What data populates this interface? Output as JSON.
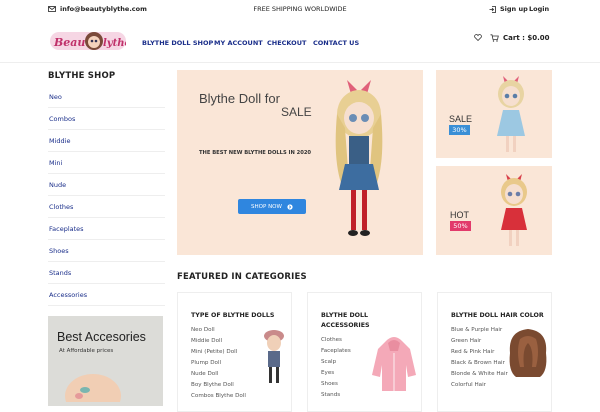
{
  "topbar": {
    "email": "info@beautyblythe.com",
    "shipping": "FREE SHIPPING WORLDWIDE",
    "signup": "Sign up",
    "login": "Login"
  },
  "header": {
    "logo_text": "Beauty Blythe",
    "nav": [
      "BLYTHE DOLL SHOP",
      "MY ACCOUNT",
      "CHECKOUT",
      "CONTACT US"
    ],
    "cart_label": "Cart : $0.00"
  },
  "sidebar": {
    "title": "BLYTHE SHOP",
    "items": [
      "Neo",
      "Combos",
      "Middie",
      "Mini",
      "Nude",
      "Clothes",
      "Faceplates",
      "Shoes",
      "Stands",
      "Accessories"
    ],
    "banner_title": "Best Accesories",
    "banner_subtitle": "At Affordable prices"
  },
  "hero": {
    "line1": "Blythe Doll for",
    "line2": "SALE",
    "tagline": "THE BEST NEW BLYTHE DOLLS IN 2020",
    "button": "SHOP NOW"
  },
  "tiles": [
    {
      "label": "SALE",
      "badge": "30%",
      "badge_color": "#3a8fd6"
    },
    {
      "label": "HOT",
      "badge": "50%",
      "badge_color": "#e23a6b"
    }
  ],
  "featured": {
    "title": "FEATURED IN CATEGORIES",
    "cards": [
      {
        "title": "TYPE OF BLYTHE DOLLS",
        "items": [
          "Neo Doll",
          "Middie Doll",
          "Mini (Petite) Doll",
          "Plump Doll",
          "Nude Doll",
          "Boy Blythe Doll",
          "Combos Blythe Doll"
        ]
      },
      {
        "title": "BLYTHE DOLL ACCESSORIES",
        "items": [
          "Clothes",
          "Faceplates",
          "Scalp",
          "Eyes",
          "Shoes",
          "Stands"
        ]
      },
      {
        "title": "BLYTHE DOLL HAIR COLOR",
        "items": [
          "Blue & Purple Hair",
          "Green Hair",
          "Red & Pink Hair",
          "Black & Brown Hair",
          "Blonde & White Hair",
          "Colorful Hair"
        ]
      }
    ]
  },
  "colors": {
    "accent": "#2f86df",
    "nav": "#1a2e8a",
    "hero_bg": "#fae6d7"
  }
}
